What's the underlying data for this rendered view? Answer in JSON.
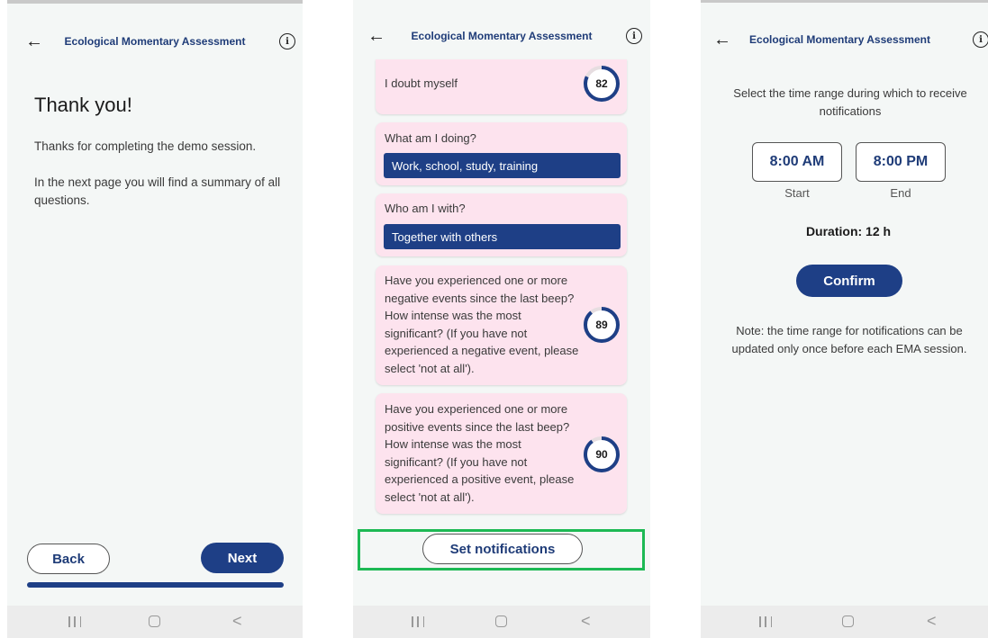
{
  "app": {
    "title": "Ecological Momentary Assessment",
    "info_icon_glyph": "i"
  },
  "colors": {
    "primary": "#1e3f86",
    "card_bg": "#fde3ee",
    "highlight": "#1db954",
    "screen_bg": "#f4f7f6"
  },
  "screen1": {
    "heading": "Thank you!",
    "paragraph1": "Thanks for completing the demo session.",
    "paragraph2": "In the next page you will find a summary of all questions.",
    "back_label": "Back",
    "next_label": "Next"
  },
  "screen2": {
    "cards": [
      {
        "question": "I doubt myself",
        "score": "82"
      },
      {
        "question": "What am I doing?",
        "answer": "Work, school, study, training"
      },
      {
        "question": "Who am I with?",
        "answer": "Together with others"
      },
      {
        "question": "Have you experienced one or more negative events since the last beep? How intense was the most significant? (If you have not experienced a negative event, please select 'not at all').",
        "score": "89"
      },
      {
        "question": "Have you experienced one or more positive events since the last beep? How intense was the most significant? (If you have not experienced a positive event, please select 'not at all').",
        "score": "90"
      }
    ],
    "set_notifications_label": "Set notifications"
  },
  "screen3": {
    "instruction": "Select the time range during which to receive notifications",
    "start_time": "8:00 AM",
    "end_time": "8:00 PM",
    "start_label": "Start",
    "end_label": "End",
    "duration": "Duration: 12 h",
    "confirm_label": "Confirm",
    "note": "Note: the time range for notifications can be updated only once before each EMA session."
  },
  "navbar": {
    "recent_icon": "recent-apps-icon",
    "home_icon": "home-icon",
    "back_icon": "back-icon",
    "back_glyph": "<"
  }
}
